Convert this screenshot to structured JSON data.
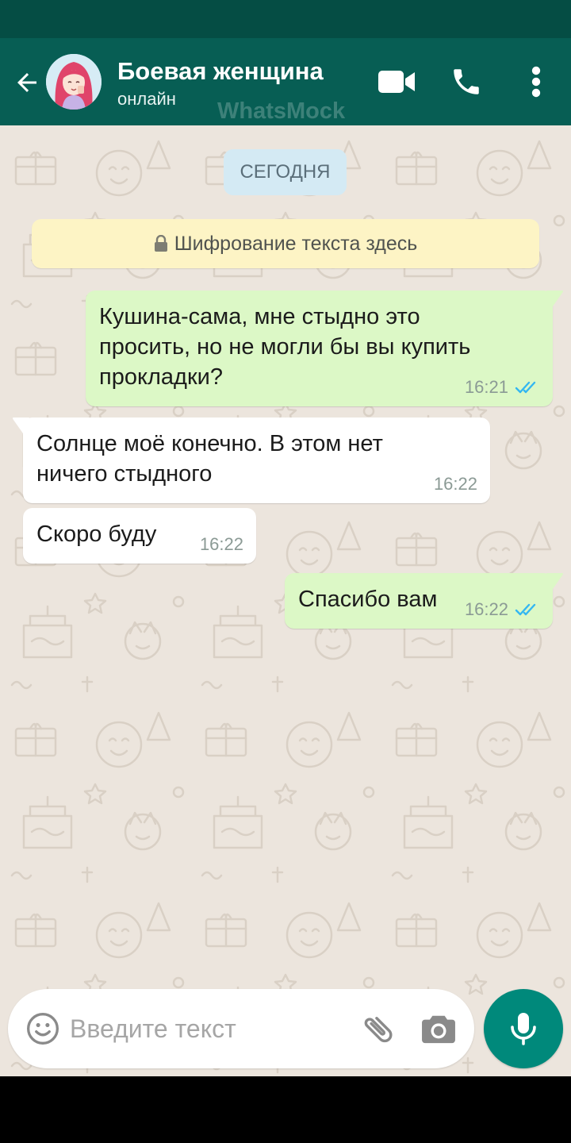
{
  "header": {
    "contact_name": "Боевая женщина",
    "contact_status": "онлайн",
    "watermark": "WhatsMock",
    "icons": [
      "back-arrow-icon",
      "video-call-icon",
      "phone-icon",
      "more-vert-icon"
    ]
  },
  "chat": {
    "date_label": "СЕГОДНЯ",
    "encryption_notice": "Шифрование текста здесь",
    "messages": [
      {
        "direction": "outgoing",
        "text": "Кушина-сама, мне стыдно это\nпросить, но не могли бы вы купить\nпрокладки?",
        "time": "16:21",
        "status": "read"
      },
      {
        "direction": "incoming",
        "text": "Солнце моё конечно. В этом нет\nничего стыдного",
        "time": "16:22"
      },
      {
        "direction": "incoming",
        "text": "Скоро буду",
        "time": "16:22"
      },
      {
        "direction": "outgoing",
        "text": "Спасибо вам",
        "time": "16:22",
        "status": "read"
      }
    ]
  },
  "composer": {
    "placeholder": "Введите текст",
    "icons": [
      "emoji-icon",
      "attach-icon",
      "camera-icon",
      "mic-icon"
    ]
  },
  "colors": {
    "header_bg": "#075e54",
    "status_bar_bg": "#054d44",
    "outgoing_bubble": "#dcf8c6",
    "incoming_bubble": "#ffffff",
    "chat_bg": "#ece5dd",
    "read_ticks": "#34b7f1",
    "mic_button": "#00897b"
  }
}
